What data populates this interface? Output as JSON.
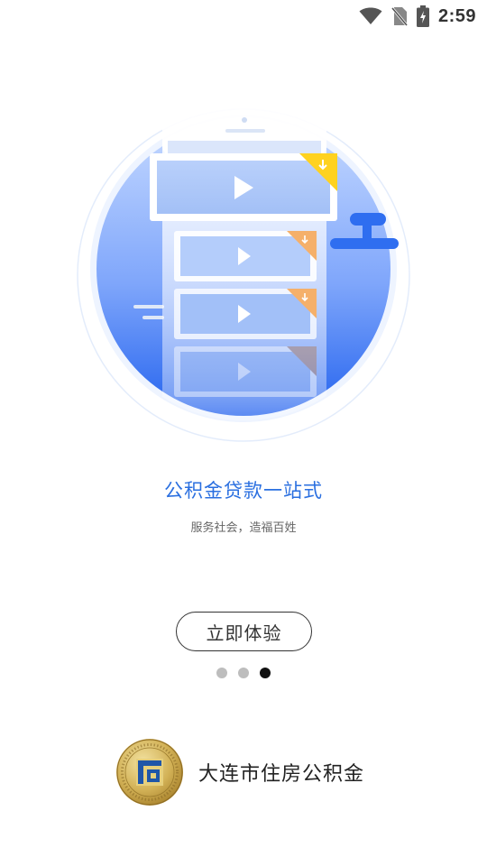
{
  "status_bar": {
    "time": "2:59",
    "icons": [
      "wifi-icon",
      "no-sim-icon",
      "battery-charging-icon"
    ]
  },
  "onboarding": {
    "headline": "公积金贷款一站式",
    "subline": "服务社会，造福百姓",
    "cta_label": "立即体验",
    "pager": {
      "total": 3,
      "active_index": 2
    }
  },
  "brand": {
    "name": "大连市住房公积金"
  },
  "colors": {
    "accent": "#2a6fe0",
    "circle_top": "#a9c8ff",
    "circle_bottom": "#2766f0",
    "ribbon_yellow": "#ffd21f",
    "ribbon_orange": "#f5b06a",
    "emblem_gold": "#c9a640",
    "emblem_blue": "#1f56a8"
  }
}
